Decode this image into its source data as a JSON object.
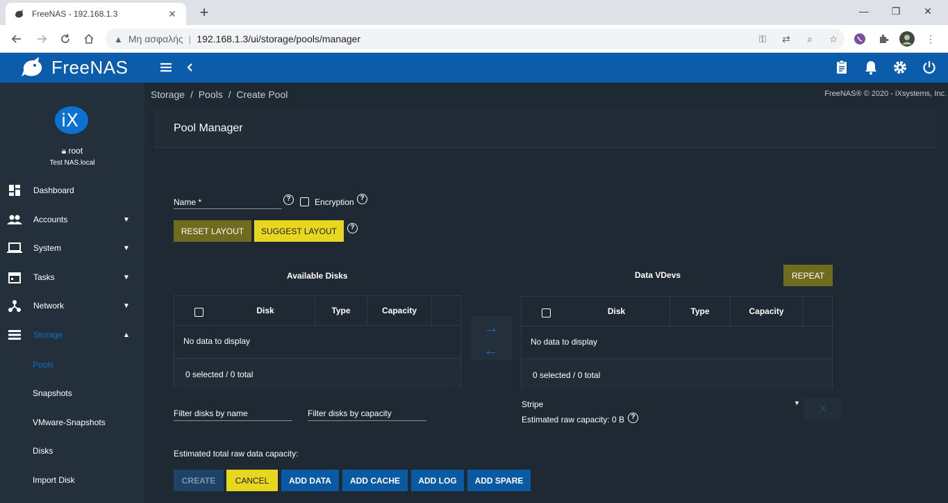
{
  "browser": {
    "tab_title": "FreeNAS - 192.168.1.3",
    "insecure_label": "Μη ασφαλής",
    "url": "192.168.1.3/ui/storage/pools/manager"
  },
  "app": {
    "logo_text": "FreeNAS"
  },
  "sidebar": {
    "user": "root",
    "host": "Test NAS.local",
    "items": [
      {
        "label": "Dashboard"
      },
      {
        "label": "Accounts"
      },
      {
        "label": "System"
      },
      {
        "label": "Tasks"
      },
      {
        "label": "Network"
      },
      {
        "label": "Storage"
      }
    ],
    "storage_sub": [
      {
        "label": "Pools"
      },
      {
        "label": "Snapshots"
      },
      {
        "label": "VMware-Snapshots"
      },
      {
        "label": "Disks"
      },
      {
        "label": "Import Disk"
      }
    ]
  },
  "breadcrumb": [
    "Storage",
    "/",
    "Pools",
    "/",
    "Create Pool"
  ],
  "copyright": "FreeNAS® © 2020 - iXsystems, Inc.",
  "pool_manager": {
    "title": "Pool Manager",
    "name_label": "Name *",
    "encryption_label": "Encryption",
    "reset_layout": "RESET LAYOUT",
    "suggest_layout": "SUGGEST LAYOUT",
    "available_disks": {
      "title": "Available Disks",
      "columns": [
        "Disk",
        "Type",
        "Capacity"
      ],
      "empty": "No data to display",
      "footer": "0 selected / 0 total",
      "filter_name": "Filter disks by name",
      "filter_capacity": "Filter disks by capacity"
    },
    "data_vdevs": {
      "title": "Data VDevs",
      "repeat": "REPEAT",
      "columns": [
        "Disk",
        "Type",
        "Capacity"
      ],
      "empty": "No data to display",
      "footer": "0 selected / 0 total",
      "layout_value": "Stripe",
      "raw_capacity": "Estimated raw capacity: 0 B",
      "remove": "X"
    },
    "total_capacity": "Estimated total raw data capacity:",
    "buttons": {
      "create": "CREATE",
      "cancel": "CANCEL",
      "add_data": "ADD DATA",
      "add_cache": "ADD CACHE",
      "add_log": "ADD LOG",
      "add_spare": "ADD SPARE"
    }
  }
}
